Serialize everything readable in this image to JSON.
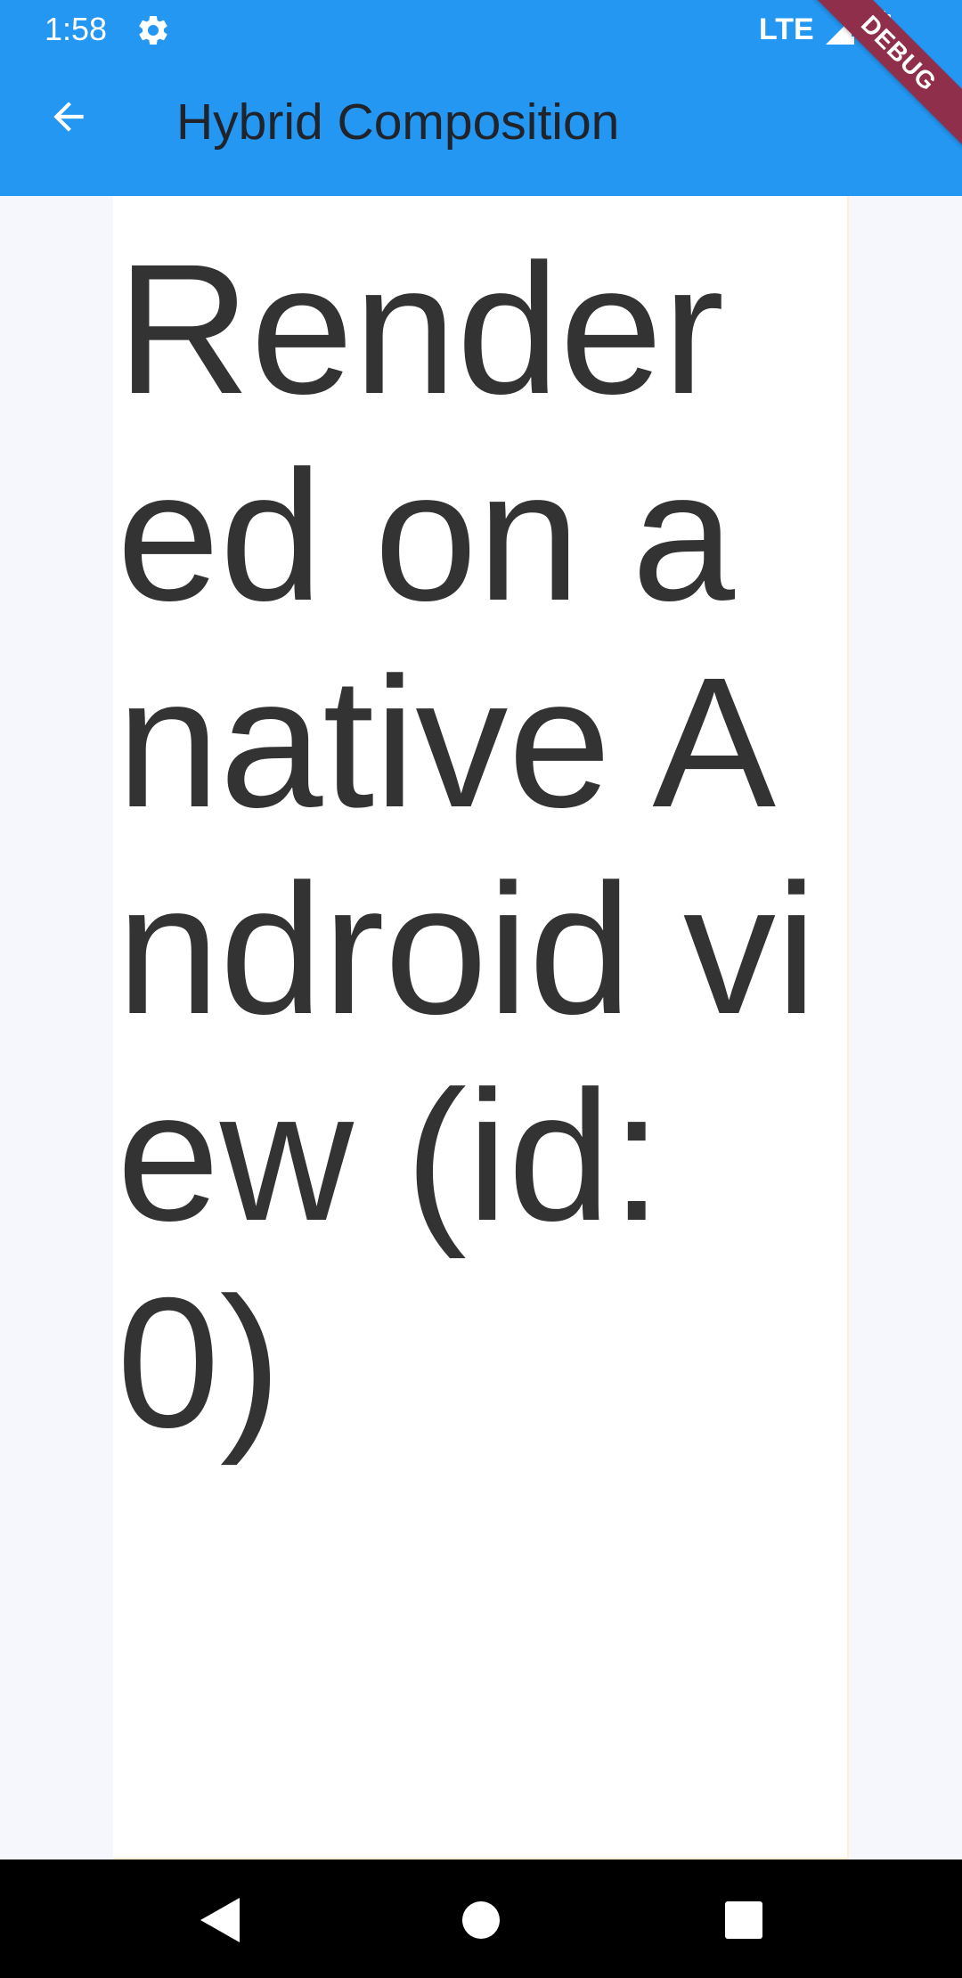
{
  "status_bar": {
    "time": "1:58",
    "network": "LTE",
    "settings_icon": "gear-icon",
    "signal_icon": "signal-icon",
    "battery_icon": "battery-icon"
  },
  "app_bar": {
    "title": "Hybrid Composition",
    "back_icon": "arrow-left-icon",
    "background_color": "#2397f2"
  },
  "debug_banner": {
    "label": "DEBUG",
    "color": "#8f2f4c"
  },
  "content": {
    "native_view_text": "Rendered on a native Android view (id: 0)",
    "text_color": "#333333",
    "view_background": "#ffffff",
    "page_background": "#f6f7fc"
  },
  "navigation_bar": {
    "back_icon": "triangle-back-icon",
    "home_icon": "circle-home-icon",
    "recent_icon": "square-recent-icon"
  }
}
